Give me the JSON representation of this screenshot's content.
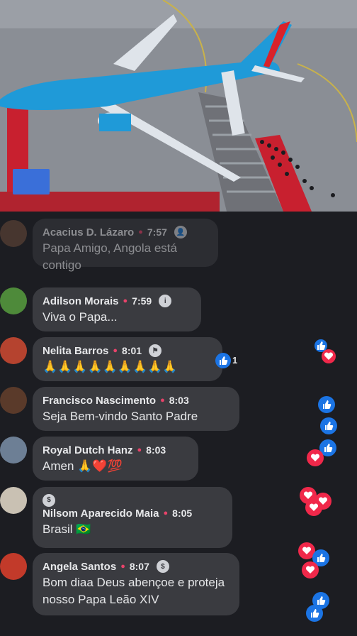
{
  "video": {
    "description_icon": "vatican-media-logo"
  },
  "comments": [
    {
      "name": "Acacius D. Lázaro",
      "time": "7:57",
      "text": "Papa Amigo, Angola está contigo",
      "badge": "person-icon"
    },
    {
      "name": "Adilson Morais",
      "time": "7:59",
      "text": "Viva o Papa...",
      "badge": "info-icon"
    },
    {
      "name": "Nelita Barros",
      "time": "8:01",
      "text": "🙏🙏🙏🙏🙏🙏🙏🙏🙏",
      "badge": "flag-icon",
      "reaction_count": "1"
    },
    {
      "name": "Francisco Nascimento",
      "time": "8:03",
      "text": "Seja Bem-vindo Santo Padre"
    },
    {
      "name": "Royal Dutch Hanz",
      "time": "8:03",
      "text": "Amen 🙏❤️💯"
    },
    {
      "name": "Nilsom Aparecido Maia",
      "time": "8:05",
      "text": "Brasil 🇧🇷",
      "badge": "dollar-icon"
    },
    {
      "name": "Angela Santos",
      "time": "8:07",
      "text": "Bom diaa Deus abençoe e proteja nosso Papa Leão XIV",
      "badge": "dollar-icon"
    }
  ],
  "colors": {
    "like": "#1b74e4",
    "love": "#f0284a",
    "bubble": "#3a3b40",
    "background": "#1c1d22"
  }
}
